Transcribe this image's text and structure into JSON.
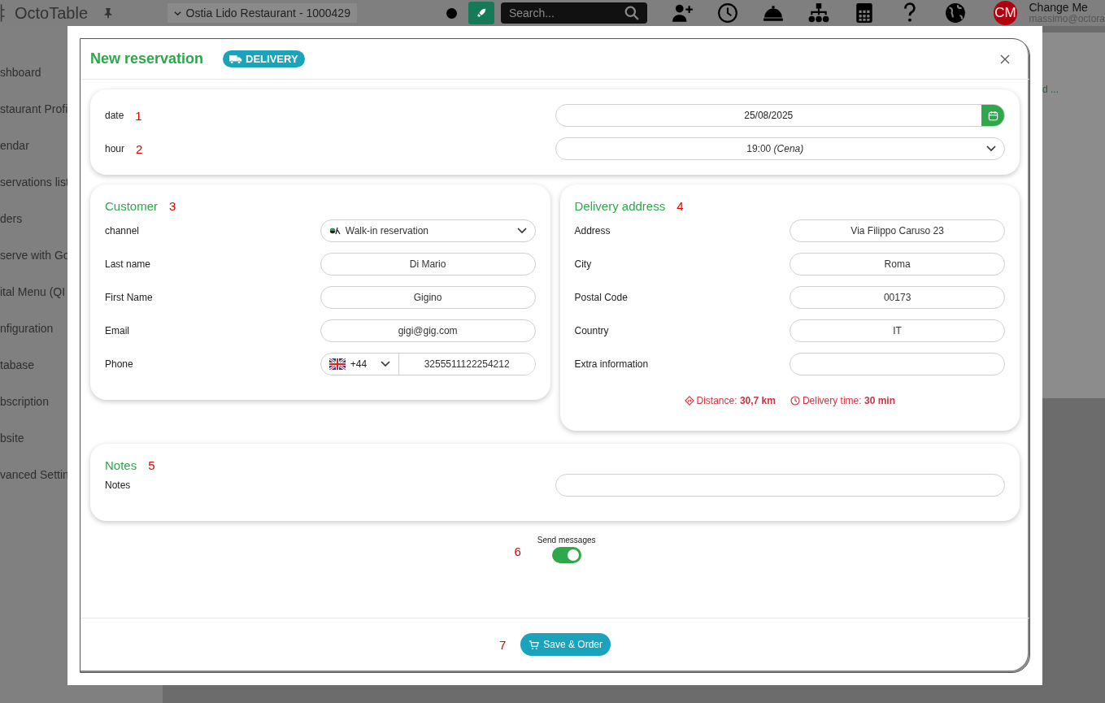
{
  "app": {
    "brand": "OctoTable",
    "restaurant": "Ostia Lido Restaurant - 1000429",
    "search_placeholder": "Search...",
    "user_initials": "CM",
    "user_name": "Change Me",
    "user_email": "massimo@octora",
    "side_note": "d ..."
  },
  "sidebar": {
    "items": [
      "shboard",
      "staurant Profi",
      "endar",
      "servations list",
      "ders",
      "serve with Go",
      "ital Menu (QI",
      "nfiguration",
      "tabase",
      "bscription",
      "bsite",
      "vanced Settin"
    ]
  },
  "modal": {
    "title": "New reservation",
    "badge": "DELIVERY",
    "schedule": {
      "fields": [
        {
          "label": "date",
          "marker": "1",
          "kind": "date",
          "value": "25/08/2025"
        },
        {
          "label": "hour",
          "marker": "2",
          "kind": "select",
          "value": "19:00 *(Cena)*"
        }
      ]
    },
    "customer": {
      "title": "Customer",
      "marker": "3",
      "fields": [
        {
          "label": "channel",
          "kind": "channel",
          "value": "Walk-in reservation"
        },
        {
          "label": "Last name",
          "kind": "text",
          "value": "Di Mario"
        },
        {
          "label": "First Name",
          "kind": "text",
          "value": "Gigino"
        },
        {
          "label": "Email",
          "kind": "text",
          "value": "gigi@gig.com"
        },
        {
          "label": "Phone",
          "kind": "phone",
          "prefix": "+44",
          "value": "3255511122254212"
        }
      ]
    },
    "delivery": {
      "title": "Delivery address",
      "marker": "4",
      "fields": [
        {
          "label": "Address",
          "value": "Via Filippo Caruso 23"
        },
        {
          "label": "City",
          "value": "Roma"
        },
        {
          "label": "Postal Code",
          "value": "00173"
        },
        {
          "label": "Country",
          "value": "IT"
        },
        {
          "label": "Extra information"
        }
      ],
      "distance": "Distance: **30,7 km**",
      "time": "Delivery time: **30 min**"
    },
    "notes": {
      "title": "Notes",
      "marker": "5",
      "fields": [
        {
          "label": "Notes"
        }
      ]
    },
    "send_messages": {
      "label": "Send messages",
      "marker": "6",
      "on": true
    },
    "save_button": {
      "label": "Save & Order",
      "marker": "7"
    }
  }
}
